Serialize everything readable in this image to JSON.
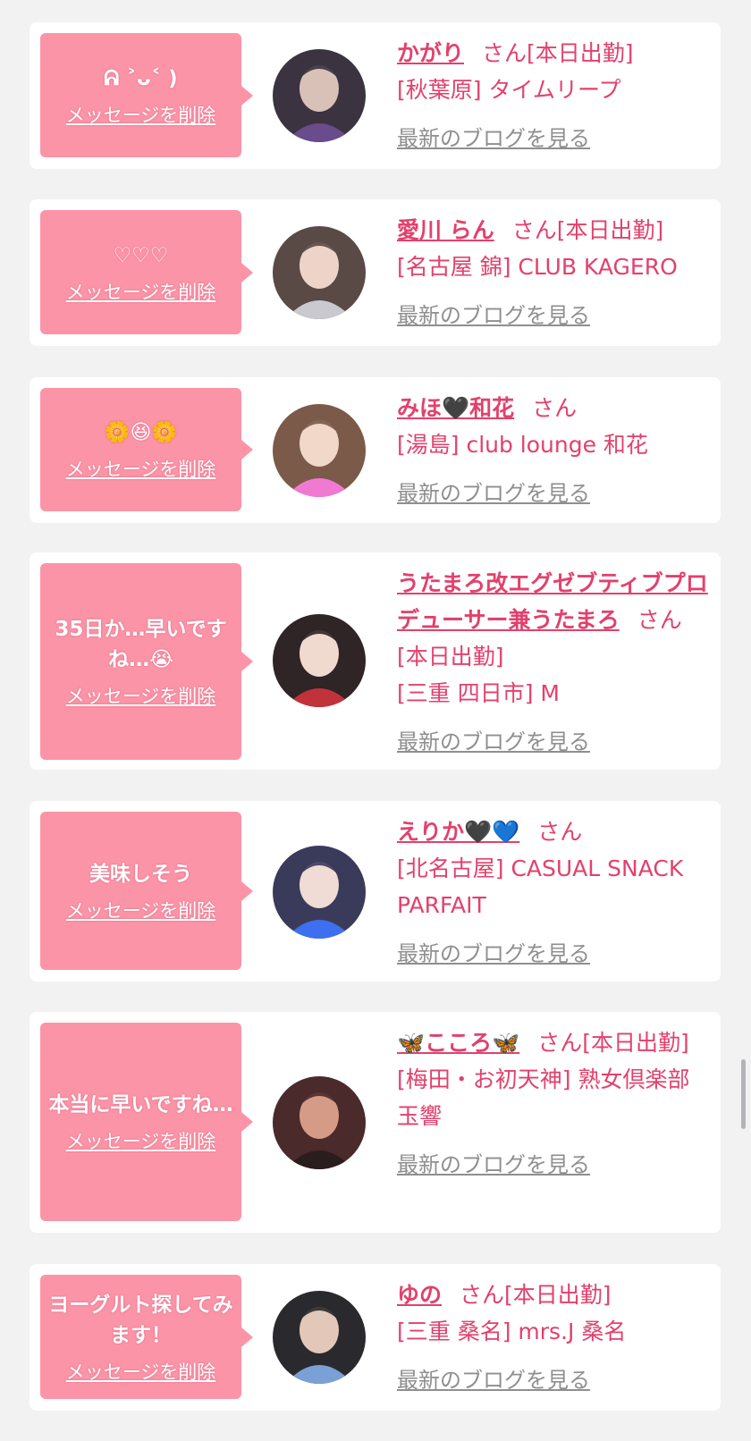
{
  "colors": {
    "accent": "#e2416c",
    "bubble": "#fc94a7",
    "card": "#ffffff",
    "background": "#f2f2f3",
    "blog_link": "#8f8f8f"
  },
  "common": {
    "delete_label": "メッセージを削除",
    "blog_label": "最新のブログを見る"
  },
  "items": [
    {
      "message": "ᕱ ˃ᴗ˂ )",
      "name": "かがり",
      "honorific": "さん",
      "status": "[本日出勤]",
      "shop": "[秋葉原] タイムリープ",
      "avatar_icon": "avatar-photo-icon"
    },
    {
      "message": "♡♡♡",
      "name": "愛川 らん",
      "honorific": "さん",
      "status": "[本日出勤]",
      "shop": "[名古屋 錦] CLUB KAGERO",
      "avatar_icon": "avatar-photo-icon"
    },
    {
      "message": "🌼😆🌼",
      "name": "みほ🖤和花",
      "honorific": "さん",
      "status": "",
      "shop": "[湯島] club lounge 和花",
      "avatar_icon": "avatar-photo-icon"
    },
    {
      "message": "35日か…早いですね…😭",
      "name": "うたまろ改エグゼブティブプロデューサー兼うたまろ",
      "honorific": "さん",
      "status": "[本日出勤]",
      "shop": "[三重 四日市] M",
      "avatar_icon": "avatar-photo-icon"
    },
    {
      "message": "美味しそう",
      "name": "えりか🖤💙",
      "honorific": "さん",
      "status": "",
      "shop": "[北名古屋] CASUAL SNACK PARFAIT",
      "avatar_icon": "avatar-photo-icon"
    },
    {
      "message": "本当に早いですね…",
      "name": "🦋こころ🦋",
      "honorific": "さん",
      "status": "[本日出勤]",
      "shop": "[梅田・お初天神] 熟女倶楽部 玉響",
      "avatar_icon": "avatar-photo-icon"
    },
    {
      "message": "ヨーグルト探してみます！",
      "name": "ゆの",
      "honorific": "さん",
      "status": "[本日出勤]",
      "shop": "[三重 桑名] mrs.J 桑名",
      "avatar_icon": "avatar-photo-icon"
    }
  ]
}
